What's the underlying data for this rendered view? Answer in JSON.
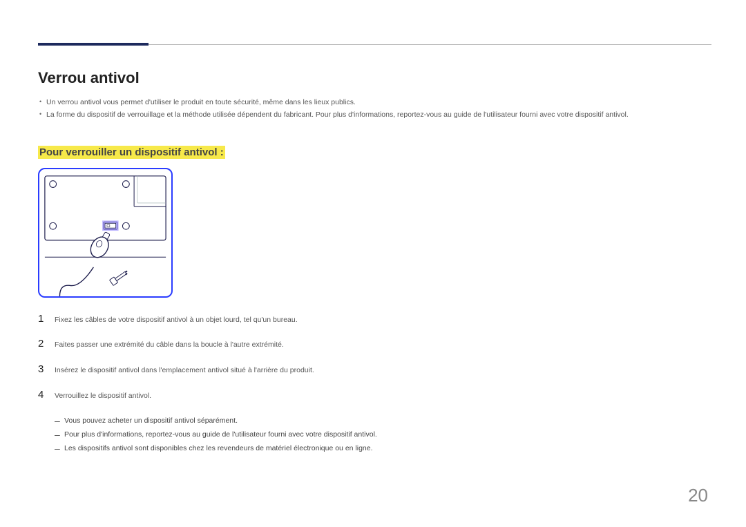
{
  "heading": "Verrou antivol",
  "bullets": [
    "Un verrou antivol vous permet d'utiliser le produit en toute sécurité, même dans les lieux publics.",
    "La forme du dispositif de verrouillage et la méthode utilisée dépendent du fabricant. Pour plus d'informations, reportez-vous au guide de l'utilisateur fourni avec votre dispositif antivol."
  ],
  "subheading": "Pour verrouiller un dispositif antivol :",
  "steps": [
    {
      "n": "1",
      "t": "Fixez les câbles de votre dispositif antivol à un objet lourd, tel qu'un bureau."
    },
    {
      "n": "2",
      "t": "Faites passer une extrémité du câble dans la boucle à l'autre extrémité."
    },
    {
      "n": "3",
      "t": "Insérez le dispositif antivol dans l'emplacement antivol situé à l'arrière du produit."
    },
    {
      "n": "4",
      "t": "Verrouillez le dispositif antivol."
    }
  ],
  "notes": [
    "Vous pouvez acheter un dispositif antivol séparément.",
    "Pour plus d'informations, reportez-vous au guide de l'utilisateur fourni avec votre dispositif antivol.",
    "Les dispositifs antivol sont disponibles chez les revendeurs de matériel électronique ou en ligne."
  ],
  "page_number": "20"
}
